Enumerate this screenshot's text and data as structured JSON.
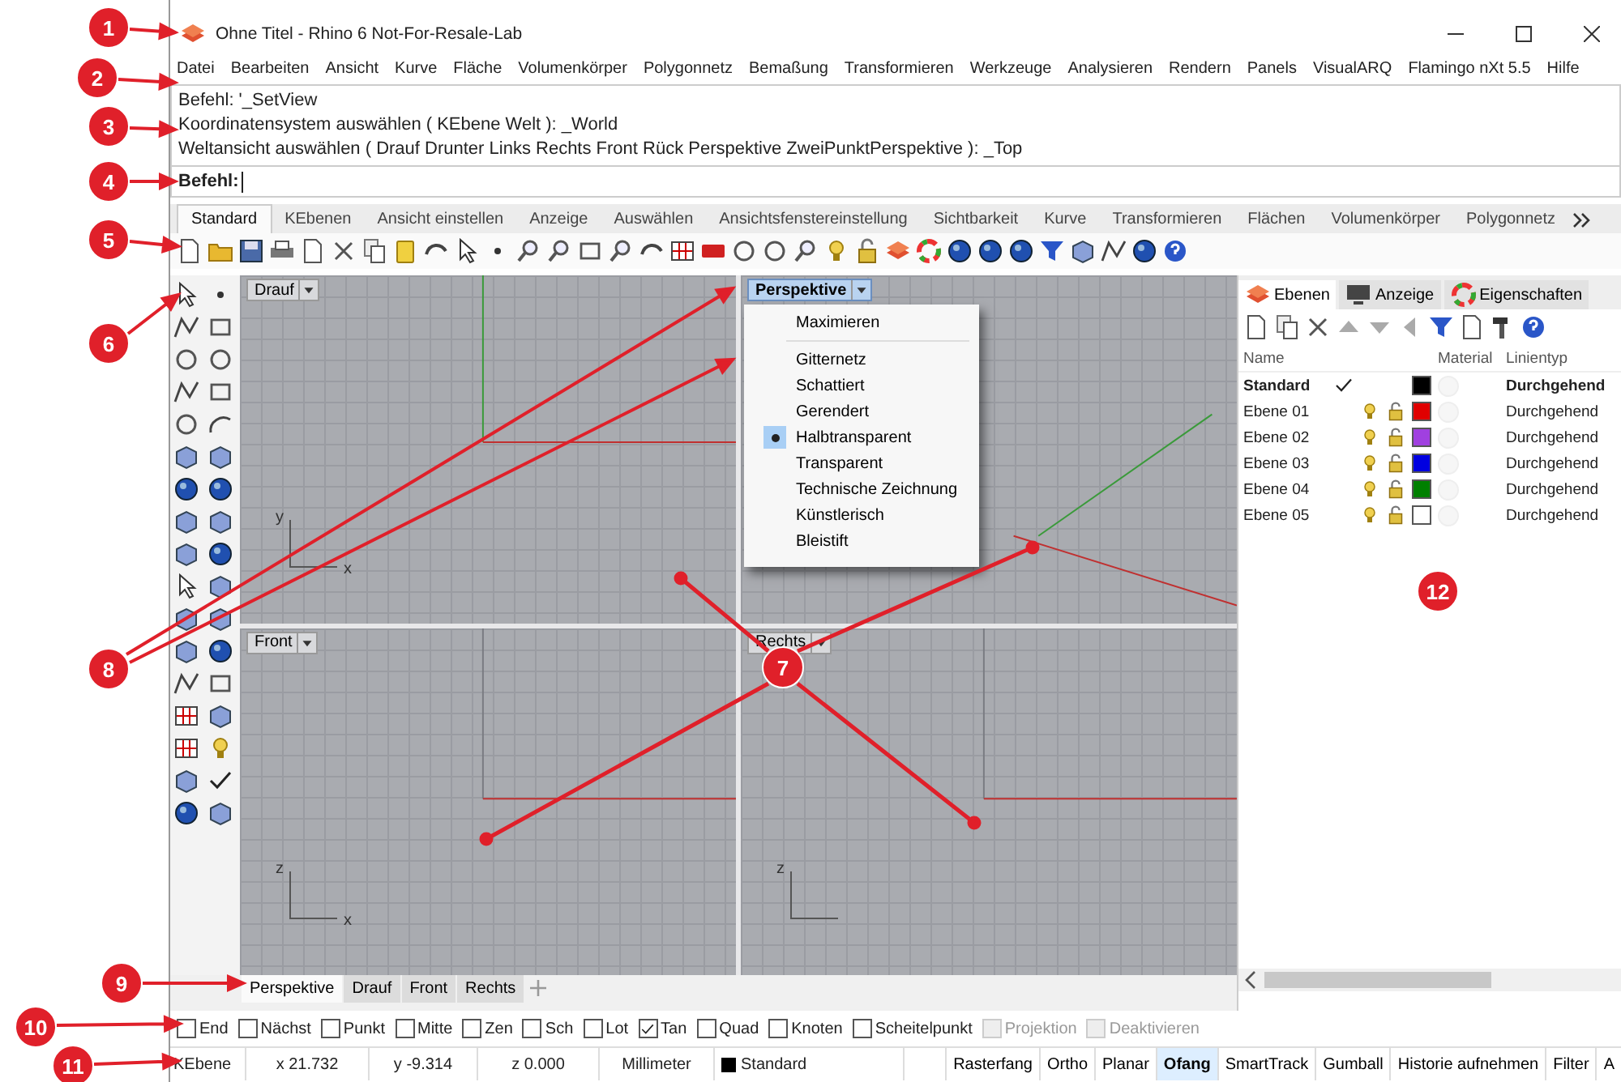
{
  "window": {
    "title": "Ohne Titel - Rhino 6 Not-For-Resale-Lab"
  },
  "menu": [
    "Datei",
    "Bearbeiten",
    "Ansicht",
    "Kurve",
    "Fläche",
    "Volumenkörper",
    "Polygonnetz",
    "Bemaßung",
    "Transformieren",
    "Werkzeuge",
    "Analysieren",
    "Rendern",
    "Panels",
    "VisualARQ",
    "Flamingo nXt 5.5",
    "Hilfe"
  ],
  "command_history": [
    "Befehl: '_SetView",
    "Koordinatensystem auswählen ( KEbene  Welt ): _World",
    "Weltansicht auswählen ( Drauf  Drunter  Links  Rechts  Front  Rück  Perspektive  ZweiPunktPerspektive ): _Top"
  ],
  "command_prompt": "Befehl:",
  "toolbar_tabs": [
    {
      "label": "Standard",
      "selected": true
    },
    {
      "label": "KEbenen",
      "selected": false
    },
    {
      "label": "Ansicht einstellen",
      "selected": false
    },
    {
      "label": "Anzeige",
      "selected": false
    },
    {
      "label": "Auswählen",
      "selected": false
    },
    {
      "label": "Ansichtsfenstereinstellung",
      "selected": false
    },
    {
      "label": "Sichtbarkeit",
      "selected": false
    },
    {
      "label": "Kurve",
      "selected": false
    },
    {
      "label": "Transformieren",
      "selected": false
    },
    {
      "label": "Flächen",
      "selected": false
    },
    {
      "label": "Volumenkörper",
      "selected": false
    },
    {
      "label": "Polygonnetz",
      "selected": false
    }
  ],
  "viewports": [
    {
      "title": "Drauf",
      "active": false,
      "axis_labels": [
        "y",
        "x"
      ]
    },
    {
      "title": "Perspektive",
      "active": true
    },
    {
      "title": "Front",
      "active": false,
      "axis_labels": [
        "z",
        "x"
      ]
    },
    {
      "title": "Rechts",
      "active": false,
      "axis_labels": [
        "z"
      ]
    }
  ],
  "display_menu": [
    {
      "kind": "item",
      "label": "Maximieren",
      "selected": false
    },
    {
      "kind": "separator"
    },
    {
      "kind": "item",
      "label": "Gitternetz",
      "selected": false
    },
    {
      "kind": "item",
      "label": "Schattiert",
      "selected": false
    },
    {
      "kind": "item",
      "label": "Gerendert",
      "selected": false
    },
    {
      "kind": "item",
      "label": "Halbtransparent",
      "selected": true
    },
    {
      "kind": "item",
      "label": "Transparent",
      "selected": false
    },
    {
      "kind": "item",
      "label": "Technische Zeichnung",
      "selected": false
    },
    {
      "kind": "item",
      "label": "Künstlerisch",
      "selected": false
    },
    {
      "kind": "item",
      "label": "Bleistift",
      "selected": false
    }
  ],
  "viewport_tabs": [
    {
      "label": "Perspektive",
      "selected": true
    },
    {
      "label": "Drauf",
      "selected": false
    },
    {
      "label": "Front",
      "selected": false
    },
    {
      "label": "Rechts",
      "selected": false
    }
  ],
  "panel": {
    "tabs": [
      {
        "label": "Ebenen",
        "selected": true
      },
      {
        "label": "Anzeige",
        "selected": false
      },
      {
        "label": "Eigenschaften",
        "selected": false
      }
    ],
    "columns": [
      "Name",
      "Material",
      "Linientyp"
    ],
    "layers": [
      {
        "name": "Standard",
        "current": true,
        "color": "#000000",
        "linetype": "Durchgehend"
      },
      {
        "name": "Ebene 01",
        "current": false,
        "color": "#e00000",
        "linetype": "Durchgehend"
      },
      {
        "name": "Ebene 02",
        "current": false,
        "color": "#a040e0",
        "linetype": "Durchgehend"
      },
      {
        "name": "Ebene 03",
        "current": false,
        "color": "#0000e0",
        "linetype": "Durchgehend"
      },
      {
        "name": "Ebene 04",
        "current": false,
        "color": "#008000",
        "linetype": "Durchgehend"
      },
      {
        "name": "Ebene 05",
        "current": false,
        "color": "#ffffff",
        "linetype": "Durchgehend"
      }
    ]
  },
  "osnaps": [
    {
      "label": "End",
      "checked": false,
      "disabled": false
    },
    {
      "label": "Nächst",
      "checked": false,
      "disabled": false
    },
    {
      "label": "Punkt",
      "checked": false,
      "disabled": false
    },
    {
      "label": "Mitte",
      "checked": false,
      "disabled": false
    },
    {
      "label": "Zen",
      "checked": false,
      "disabled": false
    },
    {
      "label": "Sch",
      "checked": false,
      "disabled": false
    },
    {
      "label": "Lot",
      "checked": false,
      "disabled": false
    },
    {
      "label": "Tan",
      "checked": true,
      "disabled": false
    },
    {
      "label": "Quad",
      "checked": false,
      "disabled": false
    },
    {
      "label": "Knoten",
      "checked": false,
      "disabled": false
    },
    {
      "label": "Scheitelpunkt",
      "checked": false,
      "disabled": false
    },
    {
      "label": "Projektion",
      "checked": false,
      "disabled": true
    },
    {
      "label": "Deaktivieren",
      "checked": false,
      "disabled": true
    }
  ],
  "status_bar": {
    "cells": [
      {
        "text": "KEbene"
      },
      {
        "text": "x 21.732"
      },
      {
        "text": "y -9.314"
      },
      {
        "text": "z 0.000"
      },
      {
        "text": "Millimeter"
      },
      {
        "text": "Standard",
        "color": "#000000"
      }
    ],
    "toggles": [
      {
        "label": "Rasterfang",
        "active": false
      },
      {
        "label": "Ortho",
        "active": false
      },
      {
        "label": "Planar",
        "active": false
      },
      {
        "label": "Ofang",
        "active": true
      },
      {
        "label": "SmartTrack",
        "active": false
      },
      {
        "label": "Gumball",
        "active": false
      },
      {
        "label": "Historie aufnehmen",
        "active": false
      },
      {
        "label": "Filter",
        "active": false
      },
      {
        "label": "A",
        "active": false
      }
    ]
  },
  "callouts": [
    "1",
    "2",
    "3",
    "4",
    "5",
    "6",
    "7",
    "8",
    "9",
    "10",
    "11",
    "12"
  ]
}
